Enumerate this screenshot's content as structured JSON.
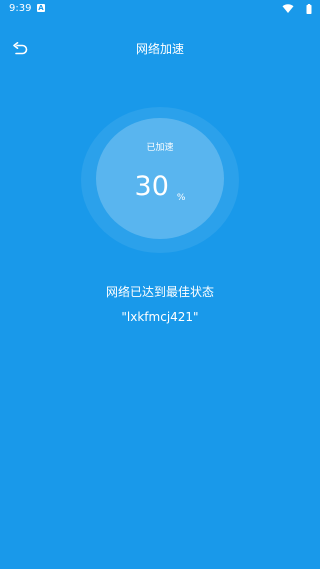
{
  "status_bar": {
    "time": "9:39",
    "notification_icon": "a-icon",
    "wifi_icon": "wifi-icon",
    "battery_icon": "battery-icon"
  },
  "header": {
    "title": "网络加速",
    "back_icon": "back-arrow-icon"
  },
  "speed_meter": {
    "status_label": "已加速",
    "value": "30",
    "unit": "%"
  },
  "result": {
    "message": "网络已达到最佳状态",
    "network_name": "\"lxkfmcj421\""
  },
  "colors": {
    "background": "#1999ea",
    "text": "#ffffff"
  }
}
